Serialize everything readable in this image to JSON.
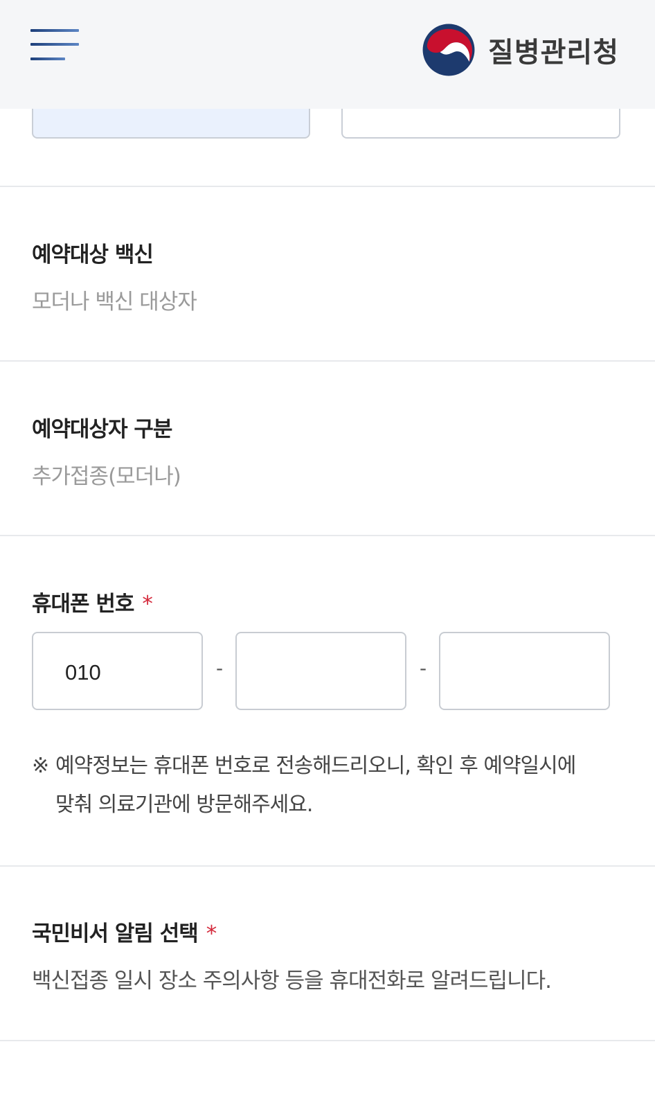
{
  "header": {
    "menu_icon": "hamburger-menu-icon",
    "emblem_icon": "korea-taegeuk-emblem-icon",
    "org_name": "질병관리청",
    "colors": {
      "emblem_red": "#c8102e",
      "emblem_blue": "#1d3a6e"
    }
  },
  "vaccine": {
    "label": "예약대상 백신",
    "value": "모더나 백신 대상자"
  },
  "target_type": {
    "label": "예약대상자 구분",
    "value": "추가접종(모더나)"
  },
  "phone": {
    "label": "휴대폰 번호",
    "required_mark": "*",
    "part1": "010",
    "part2": "",
    "part3": "",
    "separator": "-",
    "notice_mark": "※",
    "notice_line1": "예약정보는 휴대폰 번호로 전송해드리오니, 확인 후 예약일시에",
    "notice_line2": "맞춰 의료기관에 방문해주세요."
  },
  "secretary": {
    "label": "국민비서 알림 선택",
    "required_mark": "*",
    "description": "백신접종 일시 장소 주의사항 등을 휴대전화로 알려드립니다."
  },
  "colors": {
    "required": "#d4293b",
    "header_bg": "#f5f6f8",
    "divider": "#e7e9ec"
  }
}
